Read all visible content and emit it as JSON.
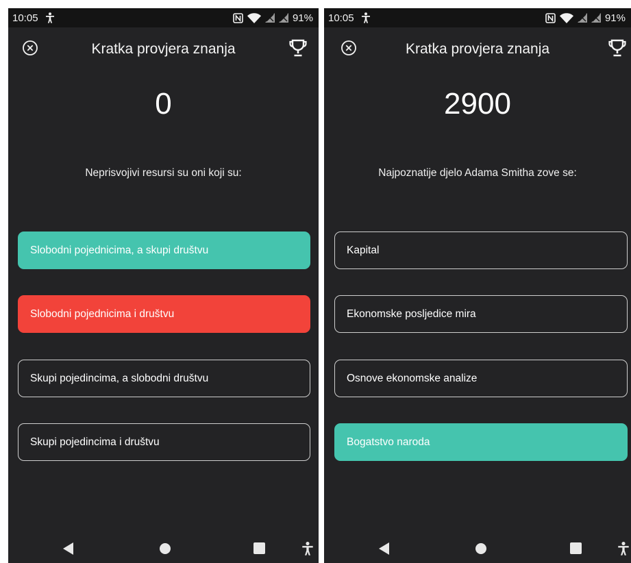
{
  "left_screen": {
    "status": {
      "time": "10:05",
      "battery": "91%"
    },
    "title": "Kratka provjera znanja",
    "score": "0",
    "question": "Neprisvojivi resursi su oni koji su:",
    "answers": [
      {
        "label": "Slobodni pojednicima, a skupi društvu",
        "state": "correct"
      },
      {
        "label": "Slobodni pojednicima i društvu",
        "state": "wrong"
      },
      {
        "label": "Skupi pojedincima, a slobodni društvu",
        "state": "neutral"
      },
      {
        "label": "Skupi pojedincima i društvu",
        "state": "neutral"
      }
    ]
  },
  "right_screen": {
    "status": {
      "time": "10:05",
      "battery": "91%"
    },
    "title": "Kratka provjera znanja",
    "score": "2900",
    "question": "Najpoznatije djelo Adama Smitha zove se:",
    "answers": [
      {
        "label": "Kapital",
        "state": "neutral"
      },
      {
        "label": "Ekonomske posljedice mira",
        "state": "neutral"
      },
      {
        "label": "Osnove ekonomske analize",
        "state": "neutral"
      },
      {
        "label": "Bogatstvo naroda",
        "state": "correct"
      }
    ]
  },
  "icons": [
    "close-icon",
    "trophy-icon",
    "nav-back-icon",
    "nav-home-icon",
    "nav-recents-icon",
    "accessibility-icon",
    "nfc-icon",
    "wifi-icon",
    "signal-icon"
  ],
  "colors": {
    "background": "#232325",
    "status_bar": "#141414",
    "correct": "#45c4ae",
    "wrong": "#f2433a",
    "border": "#cfcfcf",
    "nav_icons": "#e8e8e8"
  }
}
